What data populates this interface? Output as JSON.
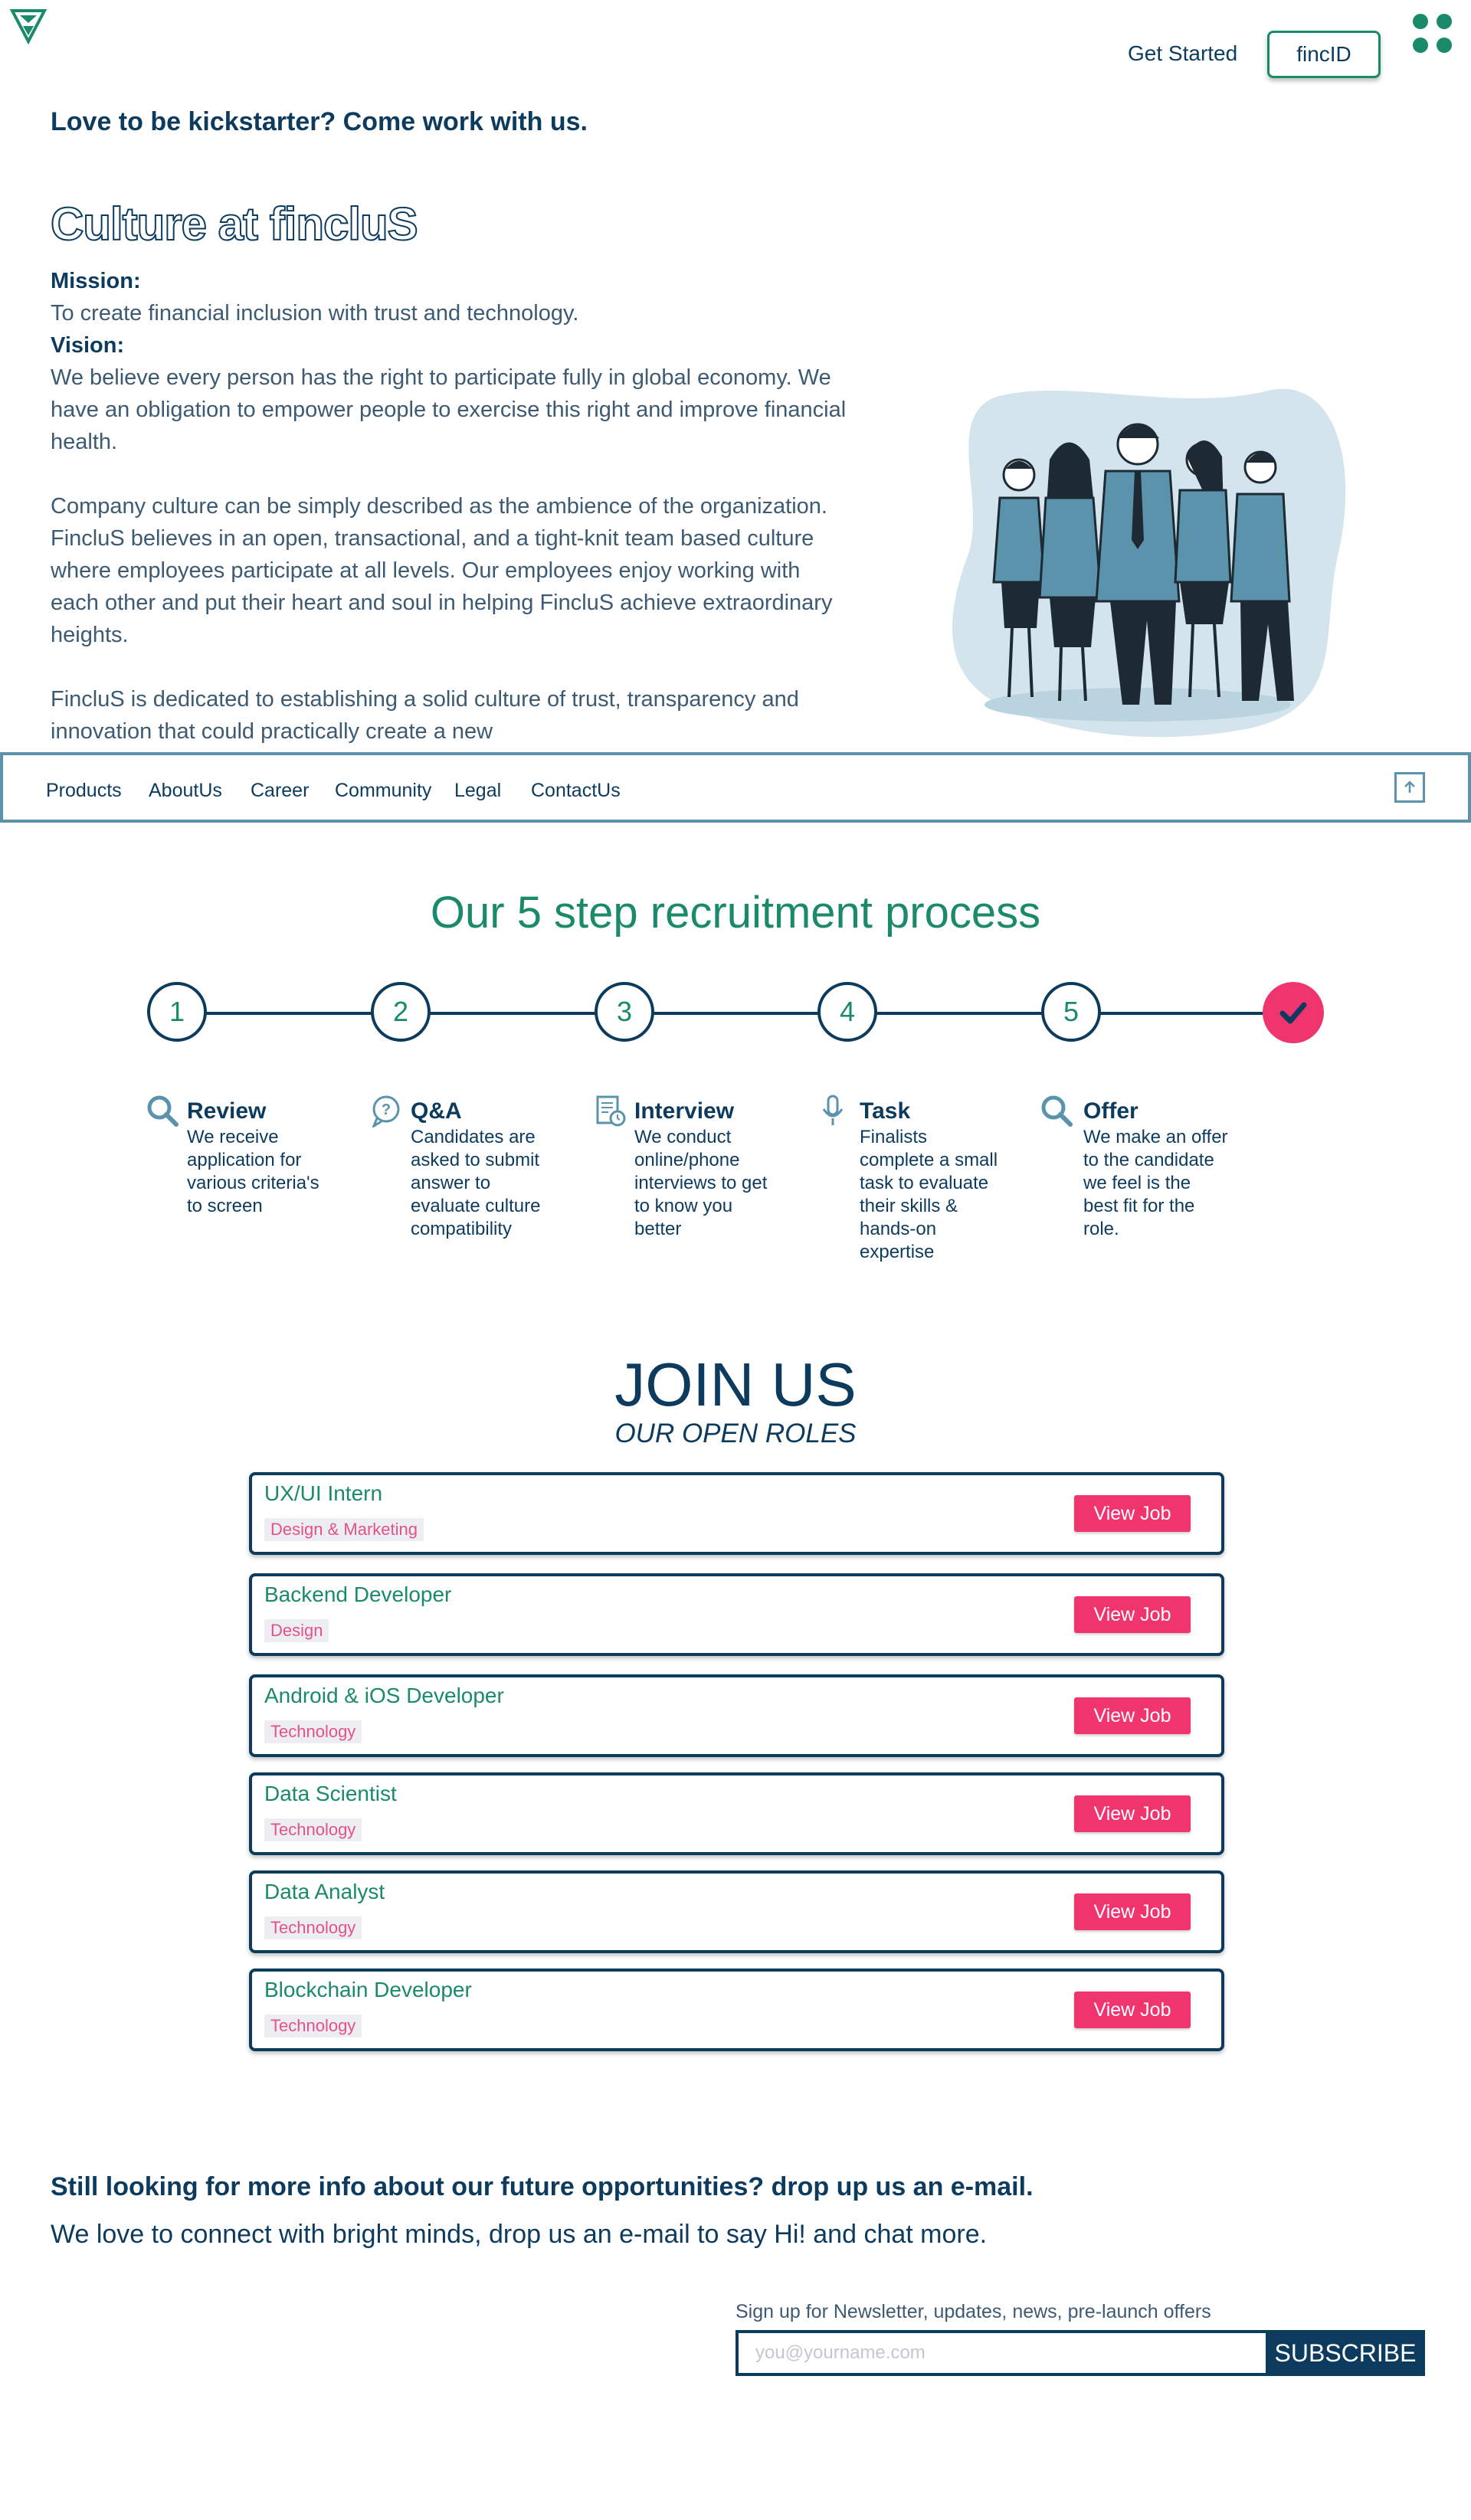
{
  "header": {
    "get_started": "Get Started",
    "fincid": "fincID"
  },
  "tagline": "Love to be kickstarter? Come work with us.",
  "culture": {
    "title": "Culture at fincluS",
    "mission_label": "Mission:",
    "mission_text": "To create financial inclusion with trust and technology.",
    "vision_label": "Vision:",
    "vision_text": "We believe every person has the right to participate fully in global economy. We have an obligation to empower people to exercise this right and improve financial health.",
    "para1": "Company culture can be simply described as the ambience of the organization. FincluS believes in an open, transactional, and a tight-knit team based culture where employees participate at all levels. Our employees enjoy working with each other and put their heart and soul in helping FincluS achieve extraordinary heights.",
    "para2": "FincluS is dedicated to establishing a solid culture of trust, transparency and innovation that could practically create a new"
  },
  "nav": {
    "items": [
      "Products",
      "AboutUs",
      "Career",
      "Community",
      "Legal",
      "ContactUs"
    ]
  },
  "process": {
    "title": "Our 5 step recruitment process",
    "steps": [
      {
        "num": "1",
        "title": "Review",
        "desc": "We receive application for various criteria's to screen",
        "icon": "search-icon"
      },
      {
        "num": "2",
        "title": "Q&A",
        "desc": "Candidates are asked to submit answer to evaluate culture compatibility",
        "icon": "question-chat-icon"
      },
      {
        "num": "3",
        "title": "Interview",
        "desc": "We conduct online/phone interviews to get to know you better",
        "icon": "document-clock-icon"
      },
      {
        "num": "4",
        "title": "Task",
        "desc": "Finalists complete a small task to evaluate their skills & hands-on expertise",
        "icon": "microphone-icon"
      },
      {
        "num": "5",
        "title": "Offer",
        "desc": "We make an offer to the candidate we feel is the best fit for the role.",
        "icon": "search-icon"
      }
    ]
  },
  "join": {
    "title": "JOIN US",
    "subtitle": "OUR OPEN ROLES",
    "view_label": "View Job",
    "jobs": [
      {
        "title": "UX/UI Intern",
        "tag": "Design & Marketing"
      },
      {
        "title": "Backend Developer",
        "tag": "Design"
      },
      {
        "title": "Android & iOS Developer",
        "tag": "Technology"
      },
      {
        "title": "Data Scientist",
        "tag": "Technology"
      },
      {
        "title": "Data Analyst",
        "tag": "Technology"
      },
      {
        "title": "Blockchain Developer",
        "tag": "Technology"
      }
    ]
  },
  "contact": {
    "heading": "Still looking for more info about our future opportunities? drop up us an e-mail.",
    "text": "We love to connect with bright minds, drop us an e-mail to say Hi! and chat more.",
    "newsletter_label": "Sign up for Newsletter, updates, news, pre-launch offers",
    "email_placeholder": "you@yourname.com",
    "subscribe": "SUBSCRIBE"
  },
  "colors": {
    "navy": "#0d3b5e",
    "green": "#1a8a6a",
    "pink": "#f0346e",
    "steel_blue": "#5b93ad"
  }
}
